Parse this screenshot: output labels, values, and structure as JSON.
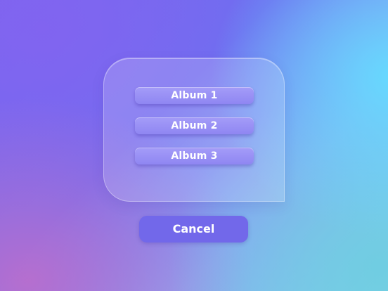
{
  "dialog": {
    "albums": [
      {
        "label": "Album 1"
      },
      {
        "label": "Album 2"
      },
      {
        "label": "Album 3"
      }
    ]
  },
  "cancel": {
    "label": "Cancel"
  },
  "colors": {
    "button": "#9a92f6",
    "cancel": "#7268ea",
    "text": "#ffffff"
  }
}
